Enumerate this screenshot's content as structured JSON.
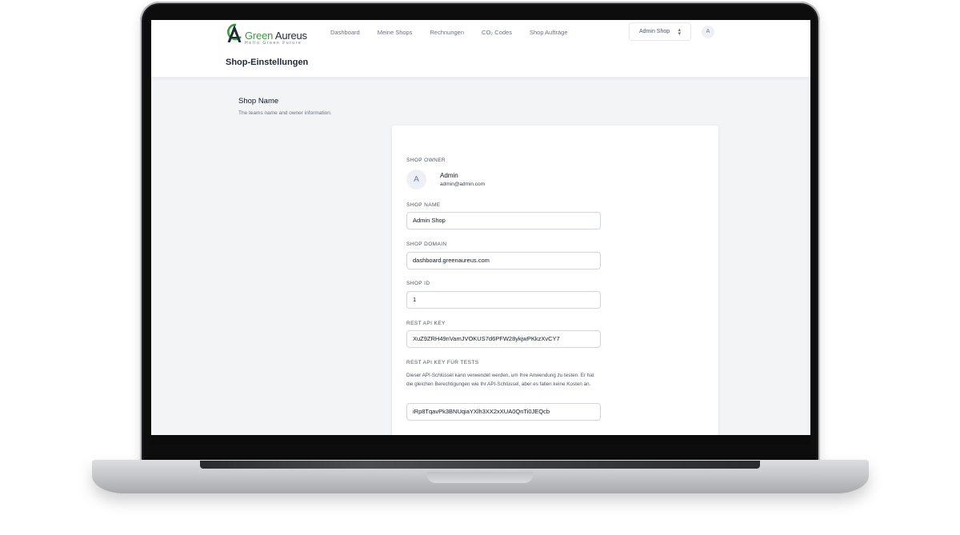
{
  "brand": {
    "name_part1": "Green",
    "name_part2": "Aureus",
    "tagline": "Hello Green Future",
    "accent_color": "#3b9b3f"
  },
  "nav": {
    "items": [
      {
        "label": "Dashboard"
      },
      {
        "label": "Meine Shops"
      },
      {
        "label": "Rechnungen"
      },
      {
        "label": "CO₂ Codes"
      },
      {
        "label": "Shop Aufträge"
      }
    ]
  },
  "shop_switcher": {
    "value": "Admin Shop",
    "icon": "chevron-up-down-icon"
  },
  "user_avatar": {
    "initial": "A"
  },
  "page": {
    "title": "Shop-Einstellungen"
  },
  "section": {
    "title": "Shop Name",
    "description": "The teams name and owner information."
  },
  "form": {
    "owner": {
      "label": "Shop Owner",
      "initial": "A",
      "name": "Admin",
      "email": "admin@admin.com"
    },
    "shop_name": {
      "label": "Shop Name",
      "value": "Admin Shop"
    },
    "shop_domain": {
      "label": "Shop Domain",
      "value": "dashboard.greenaureus.com"
    },
    "shop_id": {
      "label": "Shop ID",
      "value": "1"
    },
    "rest_api_key": {
      "label": "Rest API Key",
      "value": "XuZ9ZRH49nVamJVOKUS7d6PFW28ykjwPKkzXvCY7"
    },
    "rest_api_key_test": {
      "label": "Rest API Key für Tests",
      "help": "Dieser API-Schlüssel kann verwendet werden, um Ihre Anwendung zu testen. Er hat die gleichen Berechtigungen wie Ihr API-Schlüssel, aber es fallen keine Kosten an.",
      "value": "iRp8TqavPk3BNUqiaYXlh3XX2xXUA0QnTi0JEQcb"
    }
  }
}
